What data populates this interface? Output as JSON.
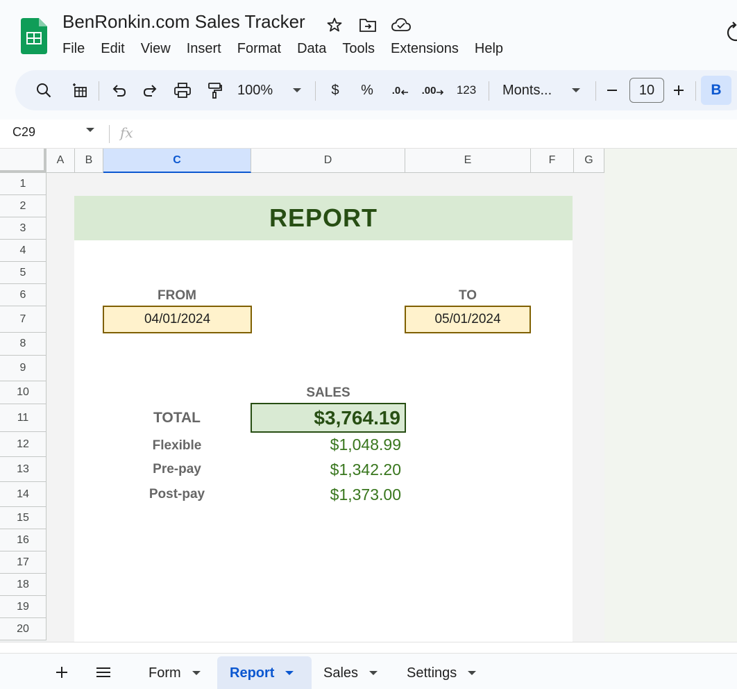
{
  "app": {
    "title": "BenRonkin.com Sales Tracker",
    "menu": [
      "File",
      "Edit",
      "View",
      "Insert",
      "Format",
      "Data",
      "Tools",
      "Extensions",
      "Help"
    ]
  },
  "toolbar": {
    "zoom": "100%",
    "currency": "$",
    "percent": "%",
    "decrease_decimal": ".0",
    "increase_decimal": ".00",
    "more_formats": "123",
    "font": "Monts...",
    "font_size": "10",
    "bold": "B"
  },
  "formula_bar": {
    "cell_ref": "C29",
    "fx": "fx"
  },
  "grid": {
    "columns": [
      "A",
      "B",
      "C",
      "D",
      "E",
      "F",
      "G"
    ],
    "active_column": "C",
    "rows": [
      "1",
      "2",
      "3",
      "4",
      "5",
      "6",
      "7",
      "8",
      "9",
      "10",
      "11",
      "12",
      "13",
      "14",
      "15",
      "16",
      "17",
      "18",
      "19",
      "20"
    ]
  },
  "report": {
    "title": "REPORT",
    "from_label": "FROM",
    "from_date": "04/01/2024",
    "to_label": "TO",
    "to_date": "05/01/2024",
    "sales_label": "SALES",
    "total_label": "TOTAL",
    "total_value": "$3,764.19",
    "breakdown": [
      {
        "label": "Flexible",
        "value": "$1,048.99"
      },
      {
        "label": "Pre-pay",
        "value": "$1,342.20"
      },
      {
        "label": "Post-pay",
        "value": "$1,373.00"
      }
    ]
  },
  "tabs": [
    {
      "label": "Form",
      "active": false
    },
    {
      "label": "Report",
      "active": true
    },
    {
      "label": "Sales",
      "active": false
    },
    {
      "label": "Settings",
      "active": false
    }
  ],
  "colors": {
    "banner_bg": "#d9ead3",
    "banner_text": "#274e13",
    "date_bg": "#fff2cc",
    "value_text": "#38761d",
    "accent": "#0b57d0"
  }
}
